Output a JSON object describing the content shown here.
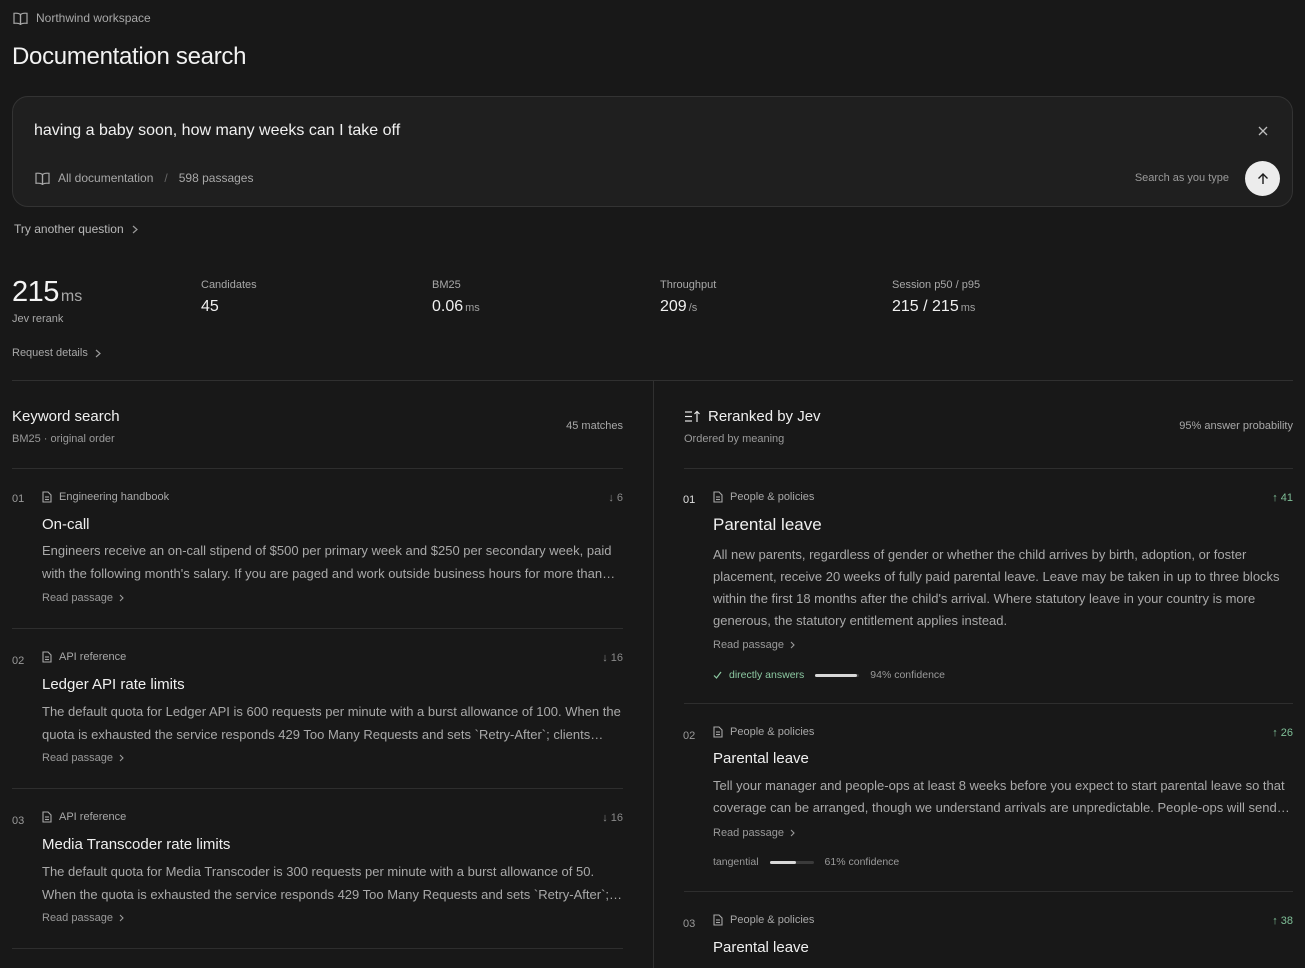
{
  "workspace": {
    "name": "Northwind workspace",
    "icon": "book-open-icon"
  },
  "page_title": "Documentation search",
  "search": {
    "query": "having a baby soon, how many weeks can I take off",
    "scope_label": "All documentation",
    "scope_count": "598 passages",
    "mode": "Search as you type",
    "clear_icon": "close-icon",
    "submit_icon": "arrow-up-icon"
  },
  "try_another": "Try another question",
  "metrics": {
    "main": {
      "value": "215",
      "unit": "ms",
      "label": "Jev rerank"
    },
    "candidates": {
      "label": "Candidates",
      "value": "45"
    },
    "bm25": {
      "label": "BM25",
      "value": "0.06",
      "unit": "ms"
    },
    "throughput": {
      "label": "Throughput",
      "value": "209",
      "unit": "/s"
    },
    "session": {
      "label": "Session p50 / p95",
      "value": "215 / 215",
      "unit": "ms"
    }
  },
  "request_details": "Request details",
  "keyword": {
    "title": "Keyword search",
    "subtitle": "BM25 · original order",
    "meta": "45 matches",
    "results": [
      {
        "rank": "01",
        "source": "Engineering handbook",
        "delta": "↓ 6",
        "title": "On-call",
        "body": "Engineers receive an on-call stipend of $500 per primary week and $250 per secondary week, paid with the following month's salary. If you are paged and work outside business hours for more than two hours in a night, you may take the next morning off.",
        "read": "Read passage"
      },
      {
        "rank": "02",
        "source": "API reference",
        "delta": "↓ 16",
        "title": "Ledger API rate limits",
        "body": "The default quota for Ledger API is 600 requests per minute with a burst allowance of 100. When the quota is exhausted the service responds 429 Too Many Requests and sets `Retry-After`; clients should back off.",
        "read": "Read passage"
      },
      {
        "rank": "03",
        "source": "API reference",
        "delta": "↓ 16",
        "title": "Media Transcoder rate limits",
        "body": "The default quota for Media Transcoder is 300 requests per minute with a burst allowance of 50. When the quota is exhausted the service responds 429 Too Many Requests and sets `Retry-After`; clients should back off.",
        "read": "Read passage"
      }
    ]
  },
  "rerank": {
    "title": "Reranked by Jev",
    "subtitle": "Ordered by meaning",
    "meta": "95% answer probability",
    "results": [
      {
        "rank": "01",
        "source": "People & policies",
        "delta": "↑ 41",
        "title": "Parental leave",
        "body": "All new parents, regardless of gender or whether the child arrives by birth, adoption, or foster placement, receive 20 weeks of fully paid parental leave. Leave may be taken in up to three blocks within the first 18 months after the child's arrival. Where statutory leave in your country is more generous, the statutory entitlement applies instead.",
        "read": "Read passage",
        "verdict": "directly answers",
        "confidence": 0.94,
        "confidence_label": "94% confidence"
      },
      {
        "rank": "02",
        "source": "People & policies",
        "delta": "↑ 26",
        "title": "Parental leave",
        "body": "Tell your manager and people-ops at least 8 weeks before you expect to start parental leave so that coverage can be arranged, though we understand arrivals are unpredictable. People-ops will send you the forms you need.",
        "read": "Read passage",
        "verdict": "tangential",
        "confidence": 0.61,
        "confidence_label": "61% confidence"
      },
      {
        "rank": "03",
        "source": "People & policies",
        "delta": "↑ 38",
        "title": "Parental leave"
      }
    ]
  }
}
